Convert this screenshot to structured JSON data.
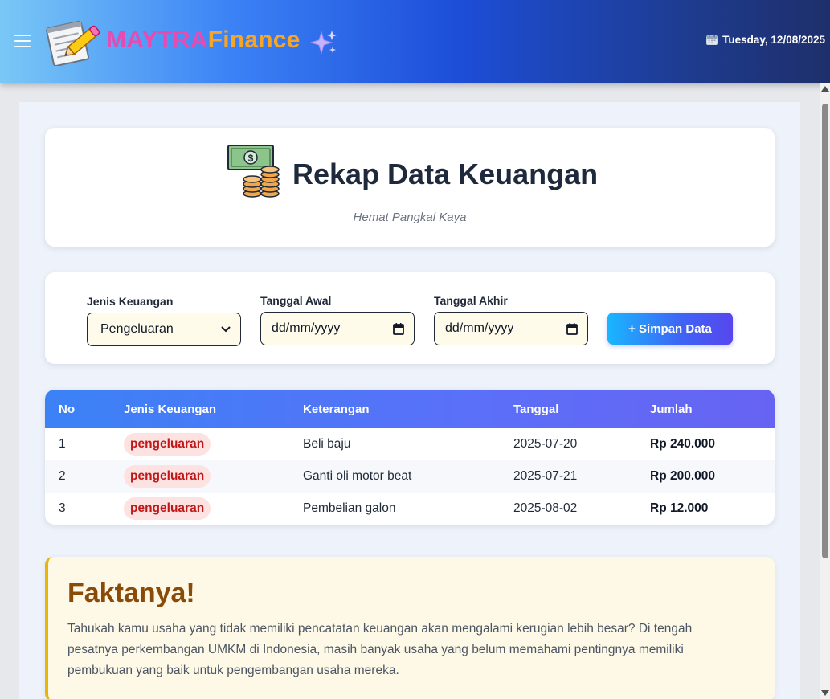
{
  "navbar": {
    "brand_part1": "MAYTRA",
    "brand_part2": "Finance",
    "date": "Tuesday, 12/08/2025"
  },
  "header": {
    "title": "Rekap Data Keuangan",
    "subtitle": "Hemat Pangkal Kaya"
  },
  "form": {
    "jenis_label": "Jenis Keuangan",
    "jenis_value": "Pengeluaran",
    "tanggal_awal_label": "Tanggal Awal",
    "tanggal_awal_placeholder": "dd/mm/yyyy",
    "tanggal_akhir_label": "Tanggal Akhir",
    "tanggal_akhir_placeholder": "dd/mm/yyyy",
    "save_label": "+ Simpan Data"
  },
  "table": {
    "headers": [
      "No",
      "Jenis Keuangan",
      "Keterangan",
      "Tanggal",
      "Jumlah"
    ],
    "rows": [
      {
        "no": "1",
        "jenis": "pengeluaran",
        "keterangan": "Beli baju",
        "tanggal": "2025-07-20",
        "jumlah": "Rp 240.000"
      },
      {
        "no": "2",
        "jenis": "pengeluaran",
        "keterangan": "Ganti oli motor beat",
        "tanggal": "2025-07-21",
        "jumlah": "Rp 200.000"
      },
      {
        "no": "3",
        "jenis": "pengeluaran",
        "keterangan": "Pembelian galon",
        "tanggal": "2025-08-02",
        "jumlah": "Rp 12.000"
      }
    ]
  },
  "fact": {
    "title": "Faktanya!",
    "text": "Tahukah kamu usaha yang tidak memiliki pencatatan keuangan akan mengalami kerugian lebih besar? Di tengah pesatnya perkembangan UMKM di Indonesia, masih banyak usaha yang belum memahami pentingnya memiliki pembukuan yang baik untuk pengembangan usaha mereka."
  },
  "colors": {
    "accent": "#3b82f6",
    "brand_pink": "#e64bb2",
    "brand_orange": "#f4a52a",
    "badge_red": "#c01818",
    "fact_title": "#8a4b08"
  },
  "icons": [
    "hamburger-menu-icon",
    "notepad-pencil-logo-icon",
    "sparkles-icon",
    "calendar-icon",
    "money-coins-icon",
    "chevron-down-icon"
  ]
}
